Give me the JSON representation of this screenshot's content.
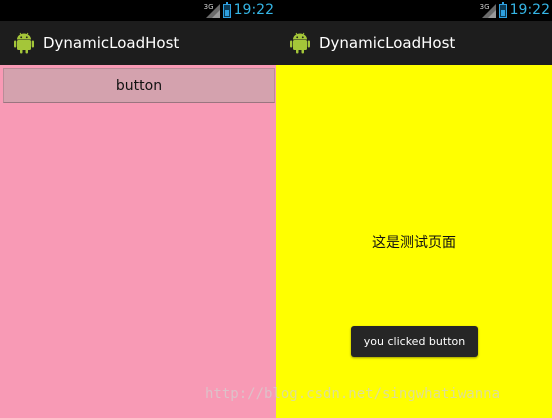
{
  "status_bar": {
    "network": "3G",
    "time": "19:22"
  },
  "app": {
    "title": "DynamicLoadHost"
  },
  "left_screen": {
    "button_label": "button",
    "background": "#f89ab5"
  },
  "right_screen": {
    "page_text": "这是测试页面",
    "background": "#ffff00",
    "toast": "you clicked button"
  },
  "watermark": "http://blog.csdn.net/singwhatiwanna",
  "icons": {
    "app": "android-icon",
    "signal": "signal-3g-icon",
    "battery": "battery-icon"
  },
  "colors": {
    "action_bar": "#1d1d1d",
    "status_bar": "#000000",
    "clock": "#35b5e5",
    "android_green": "#a4c639"
  }
}
